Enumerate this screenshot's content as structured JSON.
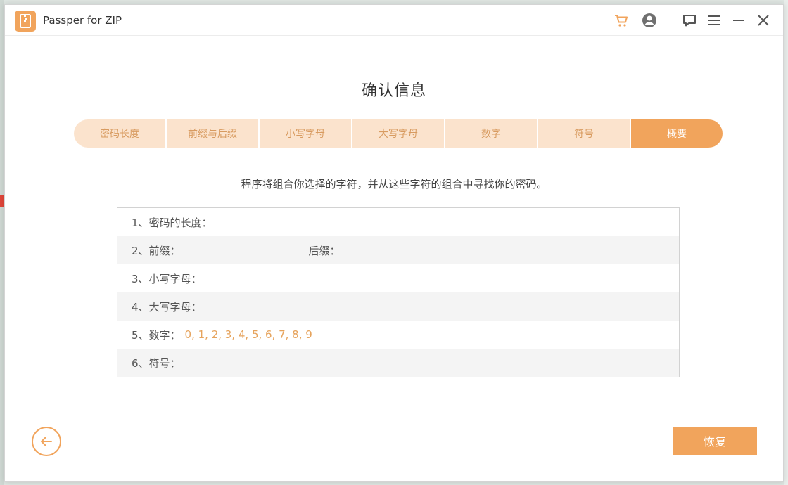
{
  "app": {
    "title": "Passper for ZIP"
  },
  "heading": "确认信息",
  "steps": [
    {
      "label": "密码长度"
    },
    {
      "label": "前缀与后缀"
    },
    {
      "label": "小写字母"
    },
    {
      "label": "大写字母"
    },
    {
      "label": "数字"
    },
    {
      "label": "符号"
    },
    {
      "label": "概要"
    }
  ],
  "active_step": 6,
  "description": "程序将组合你选择的字符，并从这些字符的组合中寻找你的密码。",
  "summary": {
    "length_label": "1、密码的长度：",
    "length_value": "",
    "prefix_label": "2、前缀：",
    "prefix_value": "",
    "suffix_label": "后缀：",
    "suffix_value": "",
    "lowercase_label": "3、小写字母：",
    "lowercase_value": "",
    "uppercase_label": "4、大写字母：",
    "uppercase_value": "",
    "digits_label": "5、数字：",
    "digits_value": "0, 1, 2, 3, 4, 5, 6, 7, 8, 9",
    "symbols_label": "6、符号：",
    "symbols_value": ""
  },
  "buttons": {
    "recover": "恢复"
  },
  "colors": {
    "accent": "#f1a45c",
    "step_inactive": "#fbe3cd",
    "value_text": "#e6a35c"
  },
  "icons": {
    "logo": "zip-file-icon",
    "cart": "cart-icon",
    "account": "account-icon",
    "feedback": "feedback-icon",
    "menu": "menu-icon",
    "minimize": "minimize-icon",
    "close": "close-icon",
    "back": "back-arrow-icon"
  }
}
